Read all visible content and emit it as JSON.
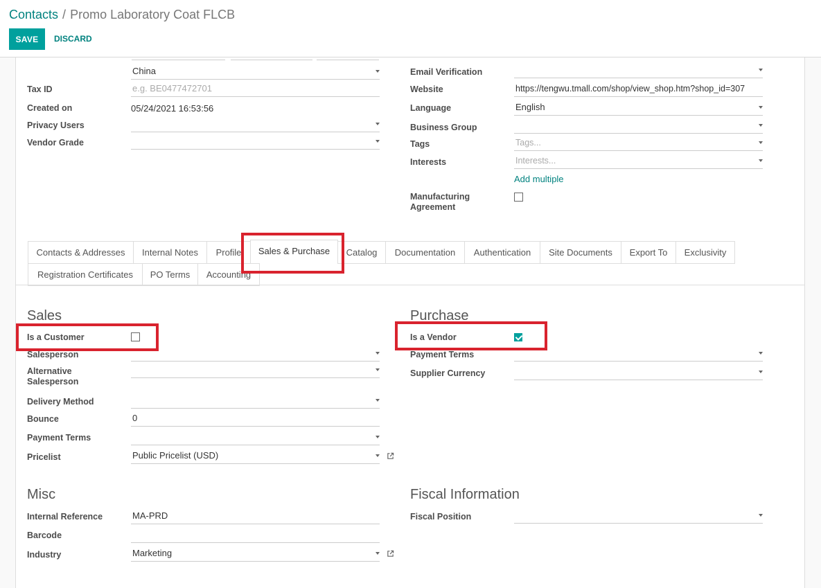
{
  "breadcrumb": {
    "parent": "Contacts",
    "separator": "/",
    "current": "Promo Laboratory Coat FLCB"
  },
  "actions": {
    "save": "SAVE",
    "discard": "DISCARD"
  },
  "left_fields": {
    "country": "China",
    "tax_id_label": "Tax ID",
    "tax_id_placeholder": "e.g. BE0477472701",
    "created_on_label": "Created on",
    "created_on_value": "05/24/2021 16:53:56",
    "privacy_users_label": "Privacy Users",
    "vendor_grade_label": "Vendor Grade"
  },
  "right_fields": {
    "email_verification_label": "Email Verification",
    "website_label": "Website",
    "website_value": "https://tengwu.tmall.com/shop/view_shop.htm?shop_id=307",
    "language_label": "Language",
    "language_value": "English",
    "business_group_label": "Business Group",
    "tags_label": "Tags",
    "tags_placeholder": "Tags...",
    "interests_label": "Interests",
    "interests_placeholder": "Interests...",
    "add_multiple": "Add multiple",
    "manufacturing_label_1": "Manufacturing",
    "manufacturing_label_2": "Agreement",
    "manufacturing_checked": false
  },
  "tabs": [
    {
      "label": "Contacts & Addresses"
    },
    {
      "label": "Internal Notes"
    },
    {
      "label": "Profile"
    },
    {
      "label": "Sales & Purchase",
      "active": true
    },
    {
      "label": "Catalog"
    },
    {
      "label": "Documentation"
    },
    {
      "label": "Authentication"
    },
    {
      "label": "Site Documents"
    },
    {
      "label": "Export To"
    },
    {
      "label": "Exclusivity"
    },
    {
      "label": "Registration Certificates"
    },
    {
      "label": "PO Terms"
    },
    {
      "label": "Accounting"
    }
  ],
  "sales": {
    "title": "Sales",
    "is_customer_label": "Is a Customer",
    "is_customer_checked": false,
    "salesperson_label": "Salesperson",
    "alt_salesperson_label_1": "Alternative",
    "alt_salesperson_label_2": "Salesperson",
    "delivery_method_label": "Delivery Method",
    "bounce_label": "Bounce",
    "bounce_value": "0",
    "payment_terms_label": "Payment Terms",
    "pricelist_label": "Pricelist",
    "pricelist_value": "Public Pricelist (USD)"
  },
  "purchase": {
    "title": "Purchase",
    "is_vendor_label": "Is a Vendor",
    "is_vendor_checked": true,
    "payment_terms_label": "Payment Terms",
    "supplier_currency_label": "Supplier Currency"
  },
  "misc": {
    "title": "Misc",
    "internal_reference_label": "Internal Reference",
    "internal_reference_value": "MA-PRD",
    "barcode_label": "Barcode",
    "industry_label": "Industry",
    "industry_value": "Marketing"
  },
  "fiscal": {
    "title": "Fiscal Information",
    "fiscal_position_label": "Fiscal Position"
  },
  "colors": {
    "accent": "#00a09d",
    "link": "#00827f",
    "highlight": "#d9232e"
  }
}
